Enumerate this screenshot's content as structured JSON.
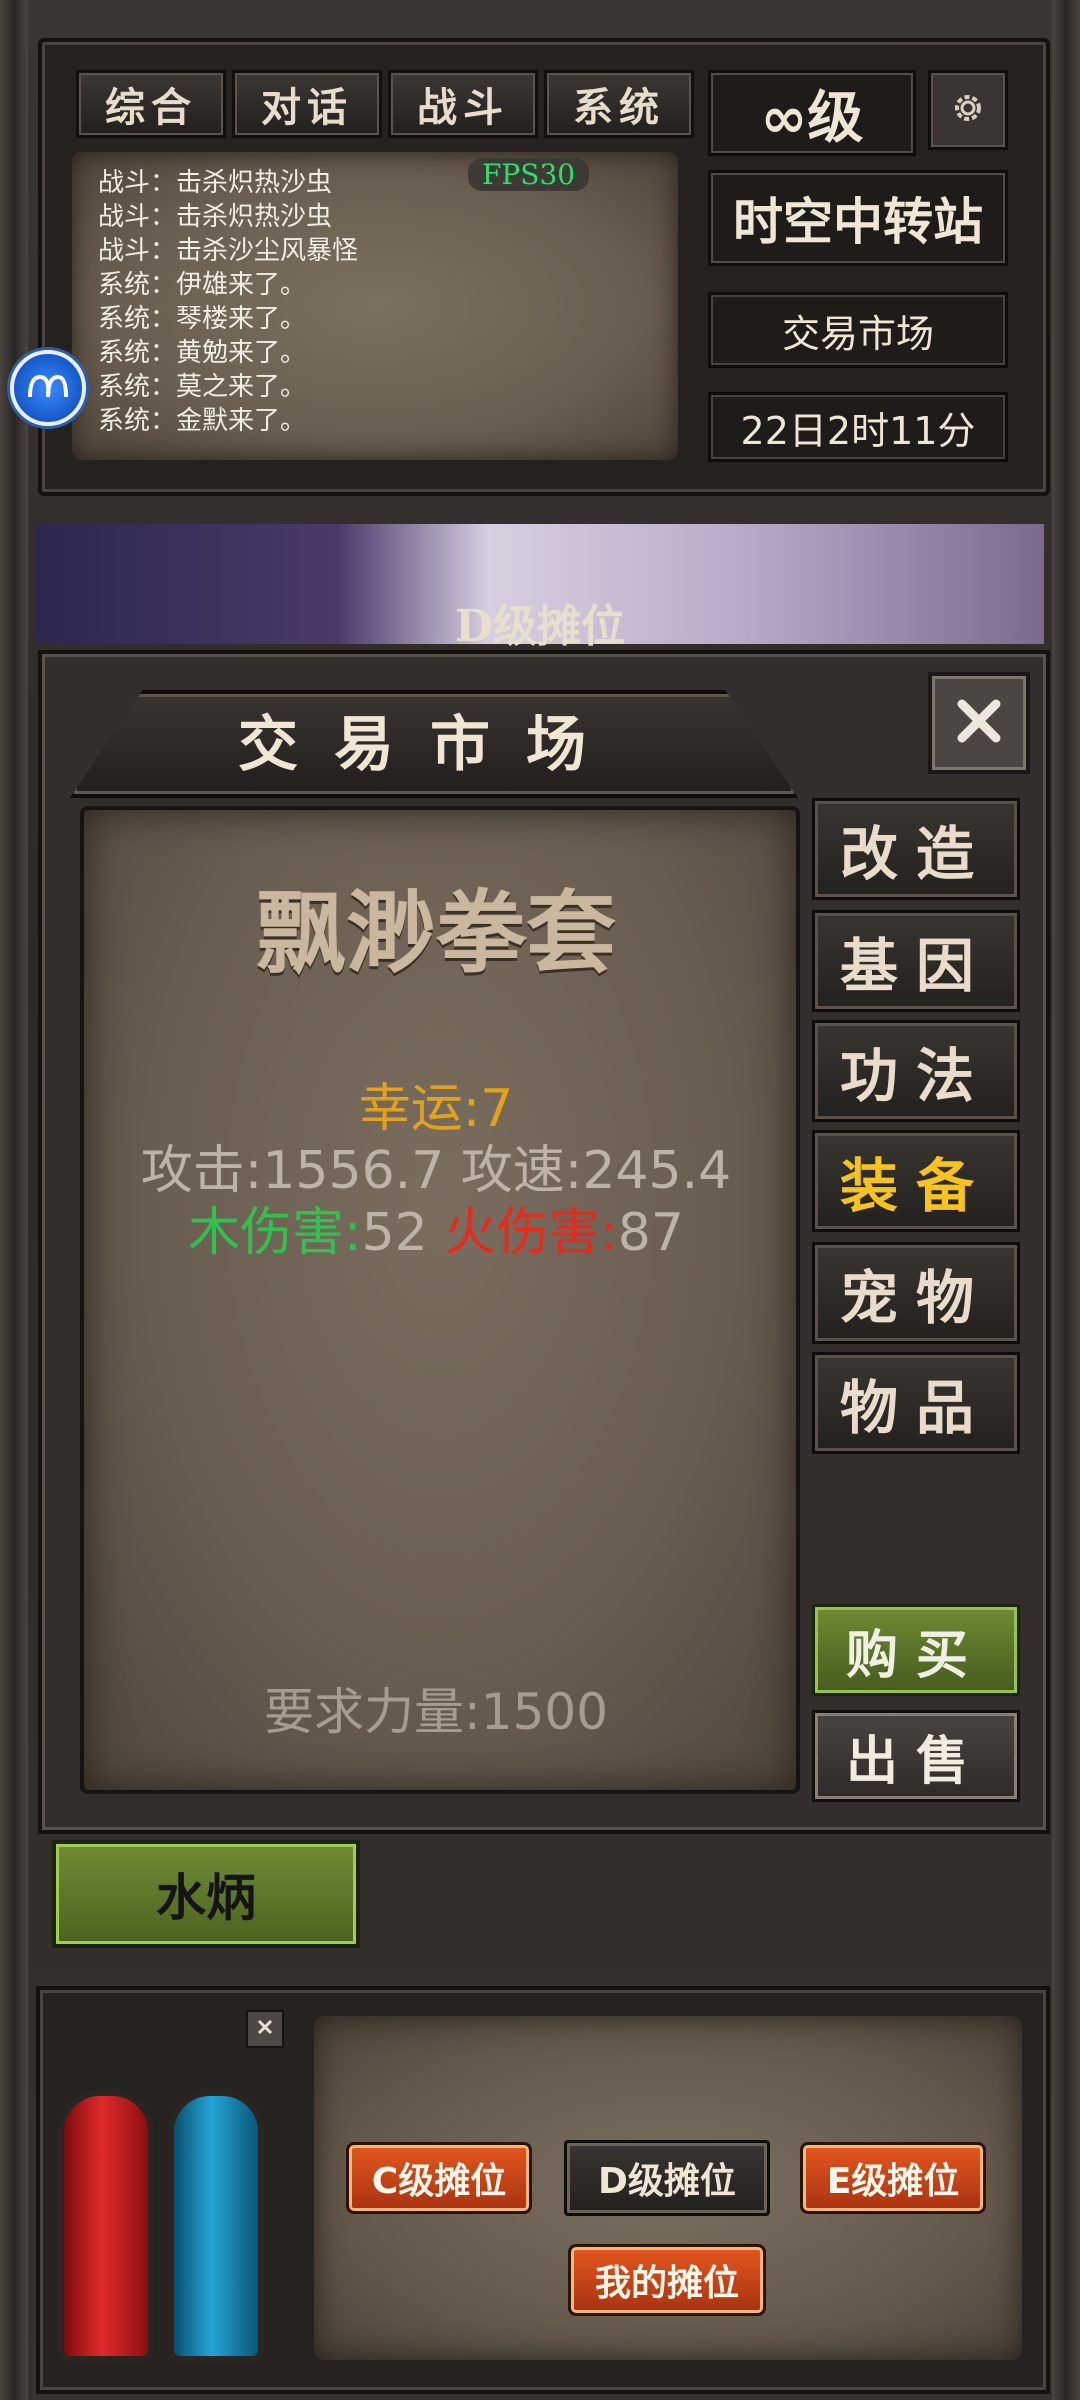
{
  "chat": {
    "tabs": [
      "综合",
      "对话",
      "战斗",
      "系统"
    ],
    "fps": "FPS30",
    "messages": [
      "战斗：击杀炽热沙虫",
      "战斗：击杀炽热沙虫",
      "战斗：击杀沙尘风暴怪",
      "系统：伊雄来了。",
      "系统：琴楼来了。",
      "系统：黄勉来了。",
      "系统：莫之来了。",
      "系统：金默来了。"
    ]
  },
  "status": {
    "level": "∞级",
    "location": "时空中转站",
    "market_label": "交易市场",
    "time": "22日2时11分"
  },
  "scene": {
    "title": "D级摊位"
  },
  "market": {
    "title": "交易市场",
    "item": {
      "name": "飘渺拳套",
      "luck_label": "幸运:7",
      "attack_line": "攻击:1556.7 攻速:245.4",
      "wood_label": "木伤害:",
      "wood_value": "52",
      "fire_label": "火伤害:",
      "fire_value": "87",
      "requirement": "要求力量:1500"
    },
    "categories": [
      "改造",
      "基因",
      "功法",
      "装备",
      "宠物",
      "物品"
    ],
    "active_category": "装备",
    "buy": "购买",
    "sell": "出售",
    "colors": {
      "luck": "#e3a21c",
      "attack": "#bdb3a6",
      "wood": "#2fc24f",
      "fire": "#e8291c",
      "neutral": "#bdb3a6",
      "active": "#f7c31e"
    }
  },
  "player": {
    "name": "水炳"
  },
  "stalls": {
    "c": "C级摊位",
    "d": "D级摊位",
    "e": "E级摊位",
    "mine": "我的摊位"
  }
}
